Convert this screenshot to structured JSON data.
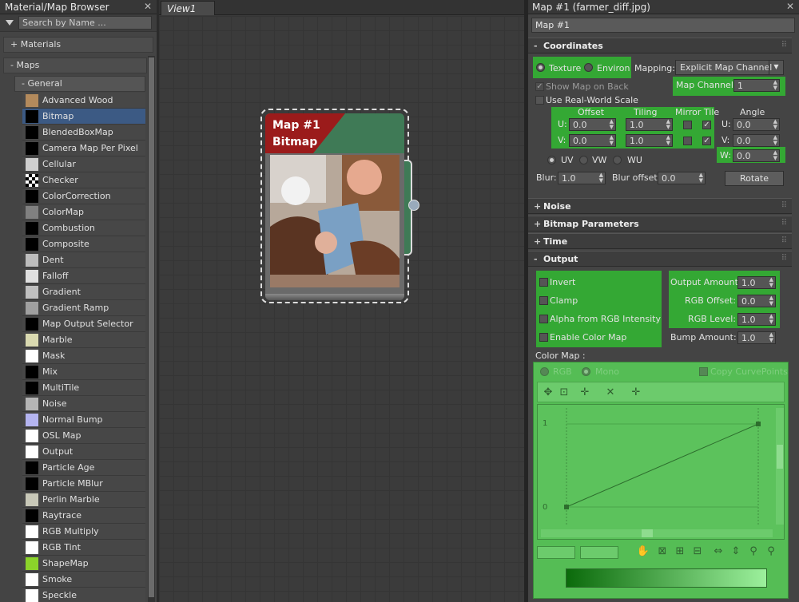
{
  "left_panel": {
    "title": "Material/Map Browser",
    "search_placeholder": "Search by Name ...",
    "groups": {
      "materials": "+ Materials",
      "maps": "- Maps",
      "general": "- General"
    },
    "items": [
      {
        "label": "Advanced Wood",
        "swatch": "#b38a5c"
      },
      {
        "label": "Bitmap",
        "swatch": "#000000",
        "selected": true
      },
      {
        "label": "BlendedBoxMap",
        "swatch": "#000000"
      },
      {
        "label": "Camera Map Per Pixel",
        "swatch": "#000000"
      },
      {
        "label": "Cellular",
        "swatch": "#cfcfcf"
      },
      {
        "label": "Checker",
        "swatch": "checker"
      },
      {
        "label": "ColorCorrection",
        "swatch": "#000000"
      },
      {
        "label": "ColorMap",
        "swatch": "#808080"
      },
      {
        "label": "Combustion",
        "swatch": "#000000"
      },
      {
        "label": "Composite",
        "swatch": "#000000"
      },
      {
        "label": "Dent",
        "swatch": "#bdbdbd"
      },
      {
        "label": "Falloff",
        "swatch": "#e0e0e0"
      },
      {
        "label": "Gradient",
        "swatch": "#c0c0c0"
      },
      {
        "label": "Gradient Ramp",
        "swatch": "#a0a0a0"
      },
      {
        "label": "Map Output Selector",
        "swatch": "#000000"
      },
      {
        "label": "Marble",
        "swatch": "#d9d9b0"
      },
      {
        "label": "Mask",
        "swatch": "#ffffff"
      },
      {
        "label": "Mix",
        "swatch": "#000000"
      },
      {
        "label": "MultiTile",
        "swatch": "#000000"
      },
      {
        "label": "Noise",
        "swatch": "#b5b5b5"
      },
      {
        "label": "Normal Bump",
        "swatch": "#b4b4f0"
      },
      {
        "label": "OSL Map",
        "swatch": "#ffffff"
      },
      {
        "label": "Output",
        "swatch": "#ffffff"
      },
      {
        "label": "Particle Age",
        "swatch": "#000000"
      },
      {
        "label": "Particle MBlur",
        "swatch": "#000000"
      },
      {
        "label": "Perlin Marble",
        "swatch": "#c8c8b8"
      },
      {
        "label": "Raytrace",
        "swatch": "#000000"
      },
      {
        "label": "RGB Multiply",
        "swatch": "#ffffff"
      },
      {
        "label": "RGB Tint",
        "swatch": "#ffffff"
      },
      {
        "label": "ShapeMap",
        "swatch": "#8bd42a"
      },
      {
        "label": "Smoke",
        "swatch": "#ffffff"
      },
      {
        "label": "Speckle",
        "swatch": "#ffffff"
      }
    ]
  },
  "view": {
    "tab_label": "View1",
    "node": {
      "title": "Map #1",
      "subtitle": "Bitmap"
    }
  },
  "right_panel": {
    "title": "Map #1  (farmer_diff.jpg)",
    "map_name": "Map #1",
    "rollouts": {
      "coordinates": "Coordinates",
      "noise": "Noise",
      "bitmap_parameters": "Bitmap Parameters",
      "time": "Time",
      "output": "Output",
      "expanded_sign": "-",
      "collapsed_sign": "+"
    },
    "coordinates": {
      "texture": "Texture",
      "environ": "Environ",
      "mapping_label": "Mapping:",
      "mapping_value": "Explicit Map Channel",
      "show_map_on_back": "Show Map on Back",
      "map_channel_label": "Map Channel:",
      "map_channel_value": "1",
      "use_real_world": "Use Real-World Scale",
      "offset": "Offset",
      "tiling": "Tiling",
      "mirror_tile": "Mirror Tile",
      "angle": "Angle",
      "u": "U:",
      "v": "V:",
      "w": "W:",
      "offset_u": "0.0",
      "offset_v": "0.0",
      "tiling_u": "1.0",
      "tiling_v": "1.0",
      "angle_u": "0.0",
      "angle_v": "0.0",
      "angle_w": "0.0",
      "uv": "UV",
      "vw": "VW",
      "wu": "WU",
      "blur_label": "Blur:",
      "blur_value": "1.0",
      "blur_offset_label": "Blur offset:",
      "blur_offset_value": "0.0",
      "rotate": "Rotate"
    },
    "output": {
      "invert": "Invert",
      "clamp": "Clamp",
      "alpha_from_rgb": "Alpha from RGB Intensity",
      "enable_color_map": "Enable Color Map",
      "output_amount_label": "Output Amount:",
      "output_amount": "1.0",
      "rgb_offset_label": "RGB Offset:",
      "rgb_offset": "0.0",
      "rgb_level_label": "RGB Level:",
      "rgb_level": "1.0",
      "bump_amount_label": "Bump Amount:",
      "bump_amount": "1.0"
    },
    "color_map": {
      "label": "Color Map :",
      "rgb": "RGB",
      "mono": "Mono",
      "copy_curve_points": "Copy CurvePoints",
      "y_top": "1",
      "y_bottom": "0"
    }
  },
  "colors": {
    "highlight": "#34a834",
    "selection": "#3c5a84",
    "node_red": "#9b1b1b",
    "node_green": "#3f7a56"
  }
}
